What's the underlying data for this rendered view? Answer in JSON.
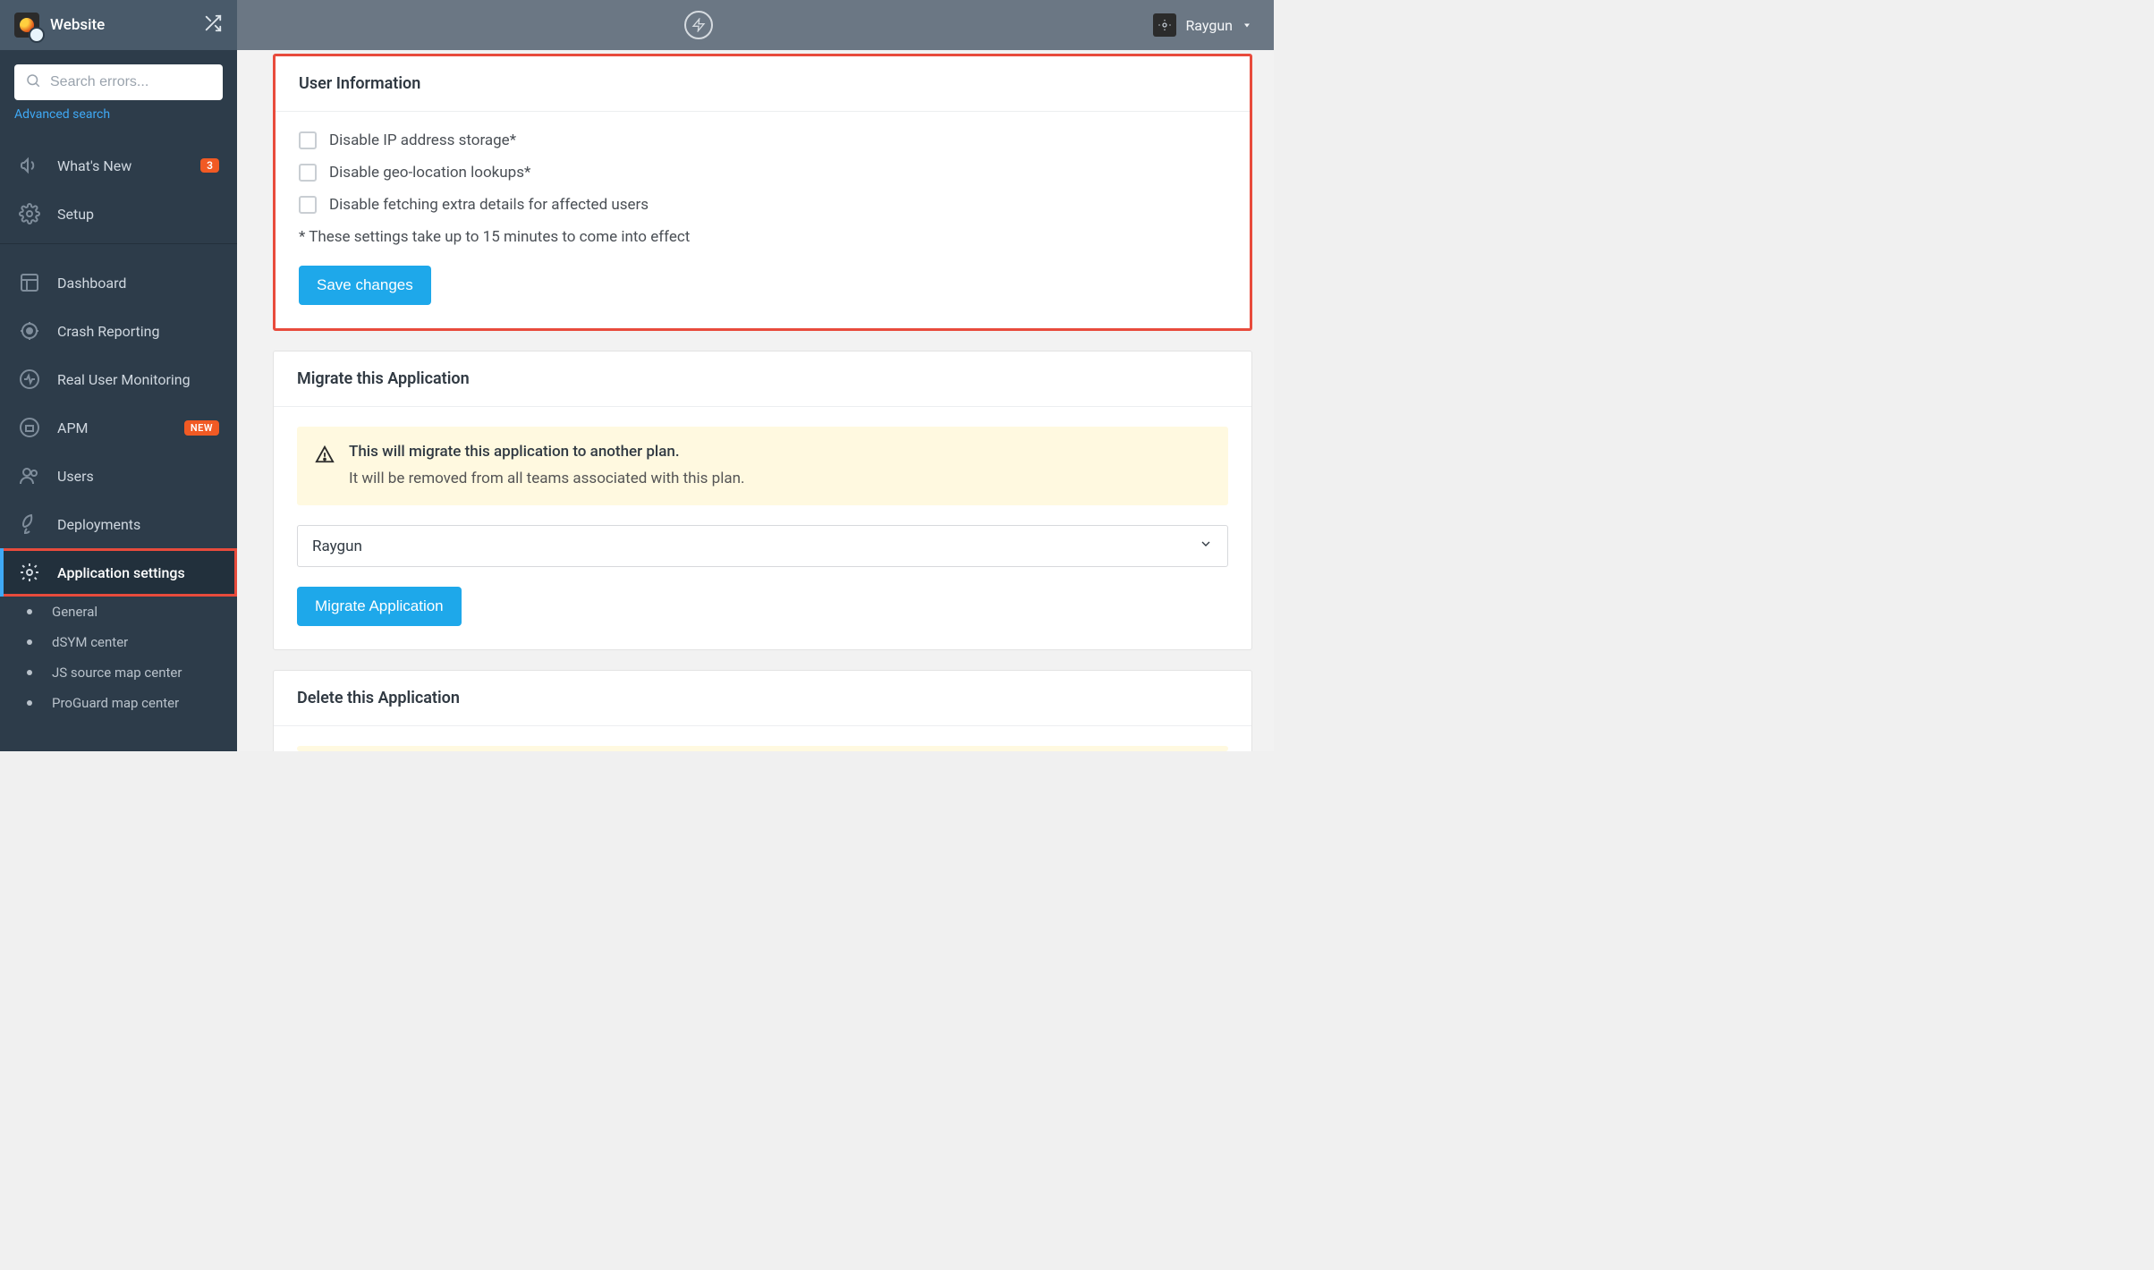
{
  "site": {
    "name": "Website"
  },
  "search": {
    "placeholder": "Search errors...",
    "advanced_label": "Advanced search"
  },
  "user": {
    "name": "Raygun"
  },
  "nav": {
    "whats_new": {
      "label": "What's New",
      "badge": "3"
    },
    "setup": {
      "label": "Setup"
    },
    "dashboard": {
      "label": "Dashboard"
    },
    "crash": {
      "label": "Crash Reporting"
    },
    "rum": {
      "label": "Real User Monitoring"
    },
    "apm": {
      "label": "APM",
      "badge": "NEW"
    },
    "users": {
      "label": "Users"
    },
    "deployments": {
      "label": "Deployments"
    },
    "app_settings": {
      "label": "Application settings"
    }
  },
  "subnav": [
    "General",
    "dSYM center",
    "JS source map center",
    "ProGuard map center"
  ],
  "panels": {
    "user_info": {
      "title": "User Information",
      "checks": [
        "Disable IP address storage*",
        "Disable geo-location lookups*",
        "Disable fetching extra details for affected users"
      ],
      "note": "* These settings take up to 15 minutes to come into effect",
      "save_btn": "Save changes"
    },
    "migrate": {
      "title": "Migrate this Application",
      "alert_line1": "This will migrate this application to another plan.",
      "alert_line2": "It will be removed from all teams associated with this plan.",
      "selected": "Raygun",
      "btn": "Migrate Application"
    },
    "delete": {
      "title": "Delete this Application"
    }
  }
}
